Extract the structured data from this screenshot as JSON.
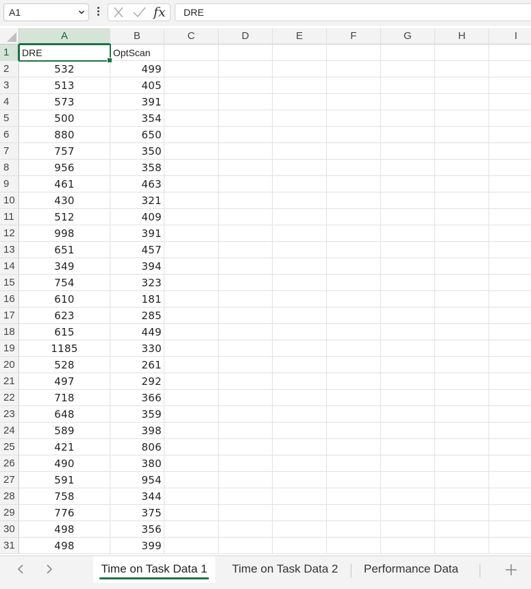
{
  "name_box": {
    "value": "A1"
  },
  "formula_bar": {
    "value": "DRE",
    "fx_label": "fx"
  },
  "columns": [
    "A",
    "B",
    "C",
    "D",
    "E",
    "F",
    "G",
    "H",
    "I"
  ],
  "header_row": {
    "a": "DRE",
    "b": "OptScan"
  },
  "rows": [
    {
      "n": "1"
    },
    {
      "n": "2",
      "a": "532",
      "b": "499"
    },
    {
      "n": "3",
      "a": "513",
      "b": "405"
    },
    {
      "n": "4",
      "a": "573",
      "b": "391"
    },
    {
      "n": "5",
      "a": "500",
      "b": "354"
    },
    {
      "n": "6",
      "a": "880",
      "b": "650"
    },
    {
      "n": "7",
      "a": "757",
      "b": "350"
    },
    {
      "n": "8",
      "a": "956",
      "b": "358"
    },
    {
      "n": "9",
      "a": "461",
      "b": "463"
    },
    {
      "n": "10",
      "a": "430",
      "b": "321"
    },
    {
      "n": "11",
      "a": "512",
      "b": "409"
    },
    {
      "n": "12",
      "a": "998",
      "b": "391"
    },
    {
      "n": "13",
      "a": "651",
      "b": "457"
    },
    {
      "n": "14",
      "a": "349",
      "b": "394"
    },
    {
      "n": "15",
      "a": "754",
      "b": "323"
    },
    {
      "n": "16",
      "a": "610",
      "b": "181"
    },
    {
      "n": "17",
      "a": "623",
      "b": "285"
    },
    {
      "n": "18",
      "a": "615",
      "b": "449"
    },
    {
      "n": "19",
      "a": "1185",
      "b": "330"
    },
    {
      "n": "20",
      "a": "528",
      "b": "261"
    },
    {
      "n": "21",
      "a": "497",
      "b": "292"
    },
    {
      "n": "22",
      "a": "718",
      "b": "366"
    },
    {
      "n": "23",
      "a": "648",
      "b": "359"
    },
    {
      "n": "24",
      "a": "589",
      "b": "398"
    },
    {
      "n": "25",
      "a": "421",
      "b": "806"
    },
    {
      "n": "26",
      "a": "490",
      "b": "380"
    },
    {
      "n": "27",
      "a": "591",
      "b": "954"
    },
    {
      "n": "28",
      "a": "758",
      "b": "344"
    },
    {
      "n": "29",
      "a": "776",
      "b": "375"
    },
    {
      "n": "30",
      "a": "498",
      "b": "356"
    },
    {
      "n": "31",
      "a": "498",
      "b": "399"
    }
  ],
  "sheet_tabs": [
    {
      "label": "Time on Task Data 1",
      "active": true
    },
    {
      "label": "Time on Task Data 2",
      "active": false
    },
    {
      "label": "Performance Data",
      "active": false
    }
  ],
  "colors": {
    "accent": "#1e7145",
    "selected_header": "#d6e4d8"
  }
}
